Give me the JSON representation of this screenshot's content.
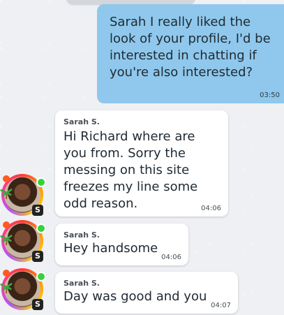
{
  "messages": [
    {
      "direction": "outgoing",
      "text": "Sarah I really liked the look of your profile, I'd be interested in chatting if you're also interested?",
      "time": "03:50"
    },
    {
      "direction": "incoming",
      "sender": "Sarah S.",
      "text": "Hi Richard where are you from. Sorry the messing on this site freezes my line some odd reason.",
      "time": "04:06"
    },
    {
      "direction": "incoming",
      "sender": "Sarah S.",
      "text": "Hey handsome",
      "time": "04:06"
    },
    {
      "direction": "incoming",
      "sender": "Sarah S.",
      "text": "Day was good and you",
      "time": "04:07"
    }
  ],
  "avatar_badge": "S",
  "colors": {
    "outgoing_bubble": "#8fc8ec",
    "incoming_bubble": "#ffffff",
    "online_dot": "#33d33a"
  }
}
